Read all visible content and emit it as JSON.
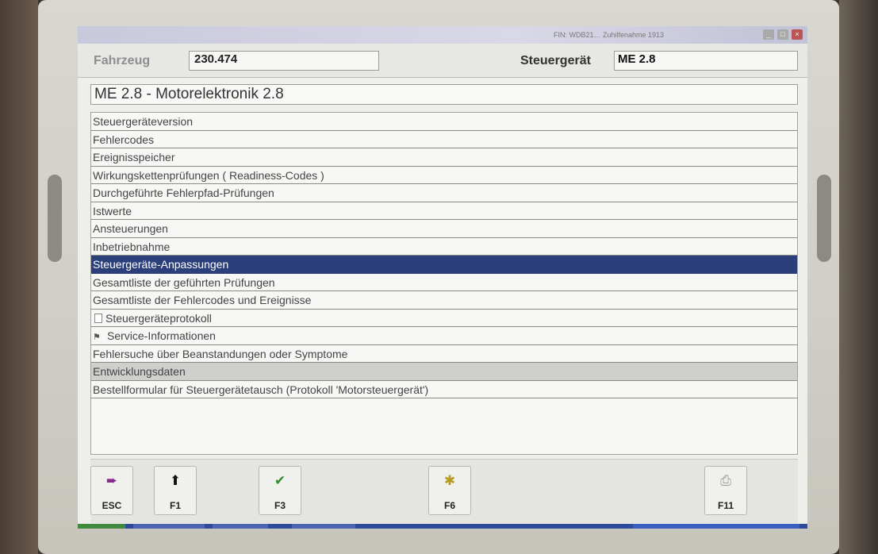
{
  "window": {
    "titlebar_text": "FIN: WDB21…  Zuhilfenahme 1913",
    "controls": [
      "_",
      "□",
      "×"
    ]
  },
  "header": {
    "vehicle_label": "Fahrzeug",
    "vehicle_value": "230.474",
    "ecu_label": "Steuergerät",
    "ecu_value": "ME 2.8"
  },
  "title": "ME 2.8 - Motorelektronik 2.8",
  "menu": {
    "items": [
      {
        "label": "Steuergeräteversion"
      },
      {
        "label": "Fehlercodes"
      },
      {
        "label": "Ereignisspeicher"
      },
      {
        "label": "Wirkungskettenprüfungen ( Readiness-Codes )"
      },
      {
        "label": "Durchgeführte Fehlerpfad-Prüfungen"
      },
      {
        "label": "Istwerte"
      },
      {
        "label": "Ansteuerungen"
      },
      {
        "label": "Inbetriebnahme"
      },
      {
        "label": "Steuergeräte-Anpassungen",
        "state": "selected"
      },
      {
        "label": "Gesamtliste der geführten Prüfungen"
      },
      {
        "label": "Gesamtliste der Fehlercodes und Ereignisse"
      },
      {
        "label": "Steuergeräteprotokoll",
        "icon": "document-icon"
      },
      {
        "label": "Service-Informationen",
        "icon": "service-book-icon"
      },
      {
        "label": "Fehlersuche über Beanstandungen oder Symptome"
      },
      {
        "label": "Entwicklungsdaten",
        "state": "highlighted"
      },
      {
        "label": "Bestellformular für Steuergerätetausch (Protokoll 'Motorsteuergerät')"
      }
    ]
  },
  "function_keys": [
    {
      "label": "ESC",
      "icon": "exit-icon"
    },
    {
      "label": "F1",
      "icon": "help-pointer-icon"
    },
    {
      "label": "F3",
      "icon": "check-icon"
    },
    {
      "label": "F6",
      "icon": "tool-icon"
    },
    {
      "label": "F11",
      "icon": "print-icon"
    }
  ],
  "colors": {
    "selection": "#2b3f7a",
    "highlight_row": "#cfcfcd",
    "taskbar": "#2f4a9a"
  }
}
